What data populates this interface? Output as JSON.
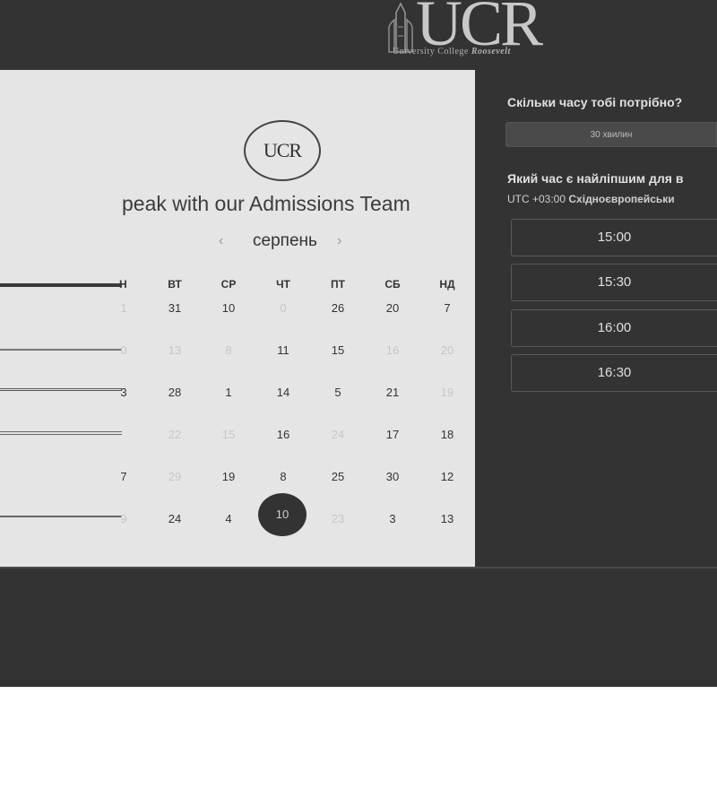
{
  "header": {
    "logo_text": "UCR",
    "logo_sub_prefix": "University College",
    "logo_sub_name": "Roosevelt"
  },
  "left": {
    "emblem_text": "UCR",
    "title": "peak with our Admissions Team",
    "month": {
      "prev": "‹",
      "label": "серпень",
      "next": "›"
    },
    "weekdays": [
      "Н",
      "ВТ",
      "СР",
      "ЧТ",
      "ПТ",
      "СБ",
      "НД"
    ],
    "rows": [
      {
        "first": "1",
        "days": [
          "31",
          "10",
          "0",
          "26",
          "20",
          "7"
        ]
      },
      {
        "first": "0",
        "days": [
          "13",
          "8",
          "11",
          "15",
          "16",
          "20"
        ]
      },
      {
        "first": "3",
        "days": [
          "28",
          "1",
          "14",
          "5",
          "21",
          "19"
        ]
      },
      {
        "first": "",
        "days": [
          "22",
          "15",
          "16",
          "24",
          "17",
          "18"
        ]
      },
      {
        "first": "7",
        "days": [
          "29",
          "19",
          "8",
          "25",
          "30",
          "12"
        ]
      },
      {
        "first": "9",
        "days": [
          "24",
          "4",
          "10",
          "23",
          "3",
          "13"
        ]
      }
    ],
    "selected_day": "10"
  },
  "right": {
    "duration_question": "Скільки часу тобі потрібно?",
    "duration_value": "30 хвилин",
    "time_question": "Який час є найліпшим для в",
    "timezone_offset": "UTC +03:00",
    "timezone_name": "Східноєвропейськи",
    "slots": [
      "15:00",
      "15:30",
      "16:00",
      "16:30"
    ]
  }
}
